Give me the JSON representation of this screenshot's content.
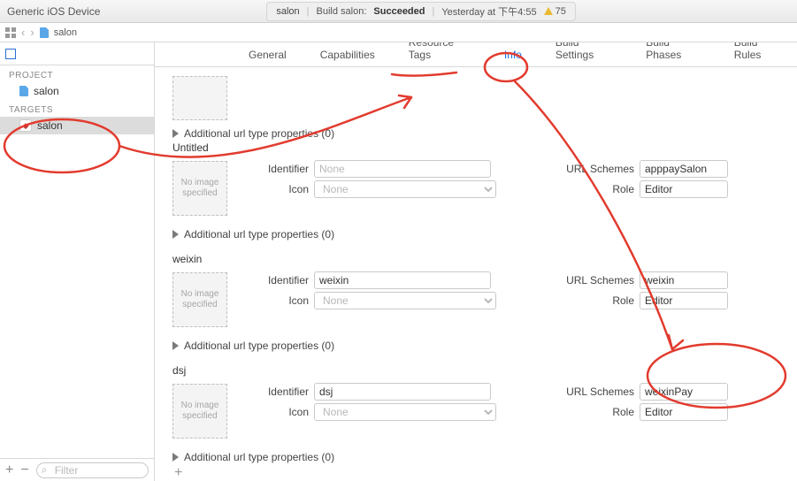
{
  "topbar": {
    "device": "Generic iOS Device",
    "project": "salon",
    "build_label": "Build salon:",
    "status": "Succeeded",
    "time": "Yesterday at 下午4:55",
    "warn_count": "75"
  },
  "pathbar": {
    "file": "salon"
  },
  "sidebar": {
    "project_label": "PROJECT",
    "project_item": "salon",
    "targets_label": "TARGETS",
    "target_item": "salon",
    "filter_placeholder": "Filter"
  },
  "tabs": {
    "general": "General",
    "capabilities": "Capabilities",
    "resource_tags": "Resource Tags",
    "info": "Info",
    "build_settings": "Build Settings",
    "build_phases": "Build Phases",
    "build_rules": "Build Rules"
  },
  "labels": {
    "identifier": "Identifier",
    "icon": "Icon",
    "url_schemes": "URL Schemes",
    "role": "Role",
    "none": "None",
    "no_image": "No image specified",
    "additional": "Additional url type properties (0)"
  },
  "url_types": [
    {
      "title": "Untitled",
      "identifier": "",
      "icon": "",
      "schemes": "apppaySalon",
      "role": "Editor"
    },
    {
      "title": "weixin",
      "identifier": "weixin",
      "icon": "",
      "schemes": "weixin",
      "role": "Editor"
    },
    {
      "title": "dsj",
      "identifier": "dsj",
      "icon": "",
      "schemes": "weixinPay",
      "role": "Editor"
    }
  ]
}
